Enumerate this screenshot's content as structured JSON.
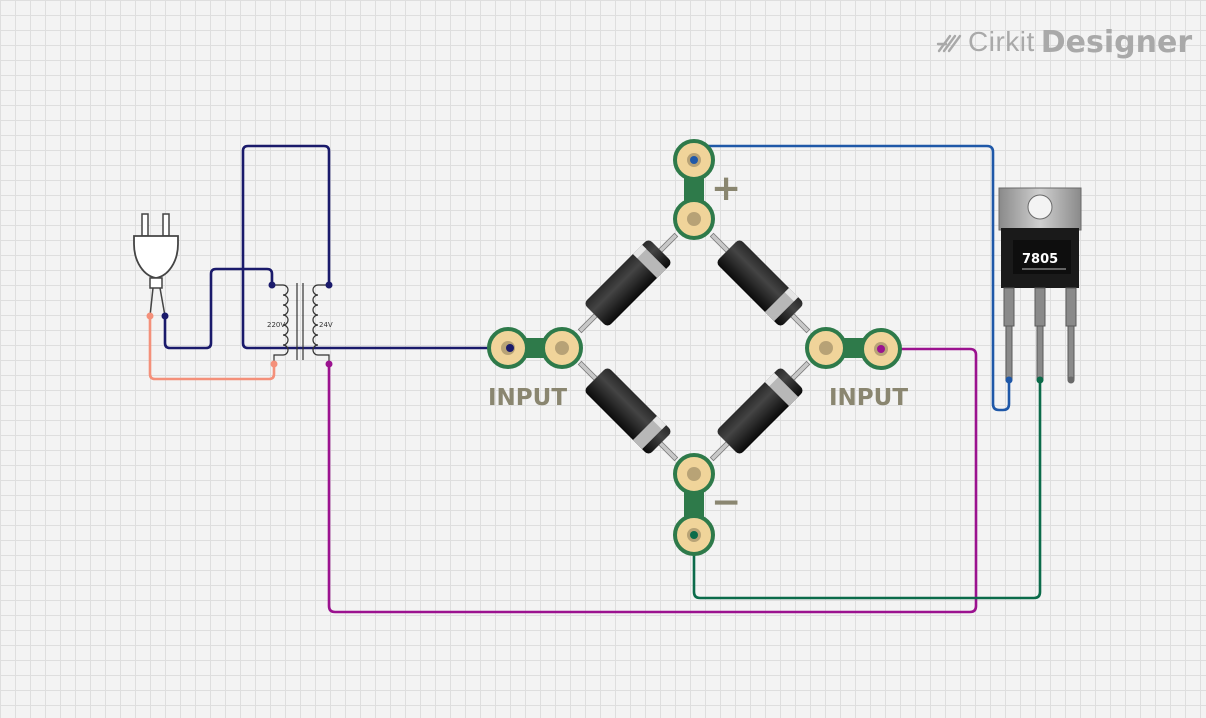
{
  "app": {
    "logo_brand": "Cirkit",
    "logo_product": "Designer"
  },
  "components": {
    "plug": {
      "name": "AC power plug"
    },
    "transformer": {
      "primary_label": "220V",
      "secondary_label": "24V"
    },
    "bridge_rectifier": {
      "input_left_label": "INPUT",
      "input_right_label": "INPUT",
      "positive_symbol": "+",
      "negative_symbol": "−"
    },
    "regulator": {
      "part_label": "7805"
    }
  },
  "wire_colors": {
    "navy": "#1a1a6b",
    "salmon": "#f4907a",
    "purple": "#9b128f",
    "blue": "#1f58a8",
    "green": "#0b6b4a"
  }
}
